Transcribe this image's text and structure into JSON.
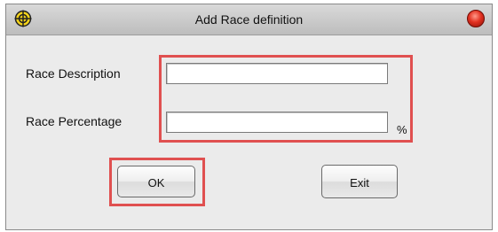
{
  "window": {
    "title": "Add Race definition",
    "app_icon": "crosshair-icon",
    "close_icon": "close-orb-icon"
  },
  "form": {
    "race_description": {
      "label": "Race Description",
      "value": ""
    },
    "race_percentage": {
      "label": "Race Percentage",
      "value": "",
      "unit": "%"
    }
  },
  "buttons": {
    "ok_label": "OK",
    "exit_label": "Exit"
  },
  "colors": {
    "highlight": "#e05050",
    "close_button": "#e23020",
    "window_bg": "#ebebeb"
  }
}
